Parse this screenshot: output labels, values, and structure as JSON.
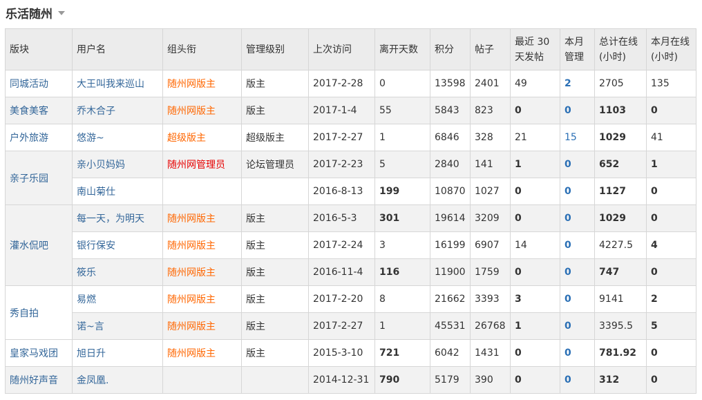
{
  "header": {
    "title": "乐活随州"
  },
  "table": {
    "columns": [
      "版块",
      "用户名",
      "组头衔",
      "管理级别",
      "上次访问",
      "离开天数",
      "积分",
      "帖子",
      "最近 30 天发帖",
      "本月管理",
      "总计在线(小时)",
      "本月在线(小时)"
    ],
    "rows": [
      {
        "board": "同城活动",
        "user": "大王叫我来巡山",
        "group": "随州网版主",
        "level": "版主",
        "last": "2017-2-28",
        "days": "0",
        "points": "13598",
        "posts": "2401",
        "recent": "49",
        "manage": "2",
        "total": "2705",
        "month": "135"
      },
      {
        "board": "美食美客",
        "user": "乔木合子",
        "group": "随州网版主",
        "level": "版主",
        "last": "2017-1-4",
        "days": "55",
        "points": "5843",
        "posts": "823",
        "recent": "0",
        "manage": "0",
        "total": "1103",
        "month": "0"
      },
      {
        "board": "户外旅游",
        "user": "悠游~",
        "group": "超级版主",
        "level": "超级版主",
        "last": "2017-2-27",
        "days": "1",
        "points": "6846",
        "posts": "328",
        "recent": "21",
        "manage": "15",
        "total": "1029",
        "month": "41"
      },
      {
        "board": "亲子乐园",
        "user": "亲小贝妈妈",
        "group": "随州网管理员",
        "level": "论坛管理员",
        "last": "2017-2-23",
        "days": "5",
        "points": "2840",
        "posts": "141",
        "recent": "1",
        "manage": "0",
        "total": "652",
        "month": "1"
      },
      {
        "board": "",
        "user": "南山菊仕",
        "group": "",
        "level": "",
        "last": "2016-8-13",
        "days": "199",
        "points": "10870",
        "posts": "1027",
        "recent": "0",
        "manage": "0",
        "total": "1127",
        "month": "0"
      },
      {
        "board": "灌水侃吧",
        "user": "每一天，为明天",
        "group": "随州网版主",
        "level": "版主",
        "last": "2016-5-3",
        "days": "301",
        "points": "19614",
        "posts": "3209",
        "recent": "0",
        "manage": "0",
        "total": "1029",
        "month": "0"
      },
      {
        "board": "",
        "user": "银行保安",
        "group": "随州网版主",
        "level": "版主",
        "last": "2017-2-24",
        "days": "3",
        "points": "16199",
        "posts": "6907",
        "recent": "14",
        "manage": "0",
        "total": "4227.5",
        "month": "4"
      },
      {
        "board": "",
        "user": "筱乐",
        "group": "随州网版主",
        "level": "版主",
        "last": "2016-11-4",
        "days": "116",
        "points": "11900",
        "posts": "1759",
        "recent": "0",
        "manage": "0",
        "total": "747",
        "month": "0"
      },
      {
        "board": "秀自拍",
        "user": "易燃",
        "group": "随州网版主",
        "level": "版主",
        "last": "2017-2-20",
        "days": "8",
        "points": "21662",
        "posts": "3393",
        "recent": "3",
        "manage": "0",
        "total": "9141",
        "month": "2"
      },
      {
        "board": "",
        "user": "诺~言",
        "group": "随州网版主",
        "level": "版主",
        "last": "2017-2-27",
        "days": "1",
        "points": "45531",
        "posts": "26768",
        "recent": "1",
        "manage": "0",
        "total": "3395.5",
        "month": "5"
      },
      {
        "board": "皇家马戏团",
        "user": "旭日升",
        "group": "随州网版主",
        "level": "版主",
        "last": "2015-3-10",
        "days": "721",
        "points": "6042",
        "posts": "1431",
        "recent": "0",
        "manage": "0",
        "total": "781.92",
        "month": "0"
      },
      {
        "board": "随州好声音",
        "user": "金凤凰.",
        "group": "",
        "level": "",
        "last": "2014-12-31",
        "days": "790",
        "points": "5179",
        "posts": "390",
        "recent": "0",
        "manage": "0",
        "total": "312",
        "month": "0"
      }
    ]
  },
  "colors": {
    "link": "#336699",
    "group_orange": "#ff6600",
    "group_red": "#e60000",
    "manage_blue": "#2a6fb5",
    "header_bg": "#ececec"
  }
}
